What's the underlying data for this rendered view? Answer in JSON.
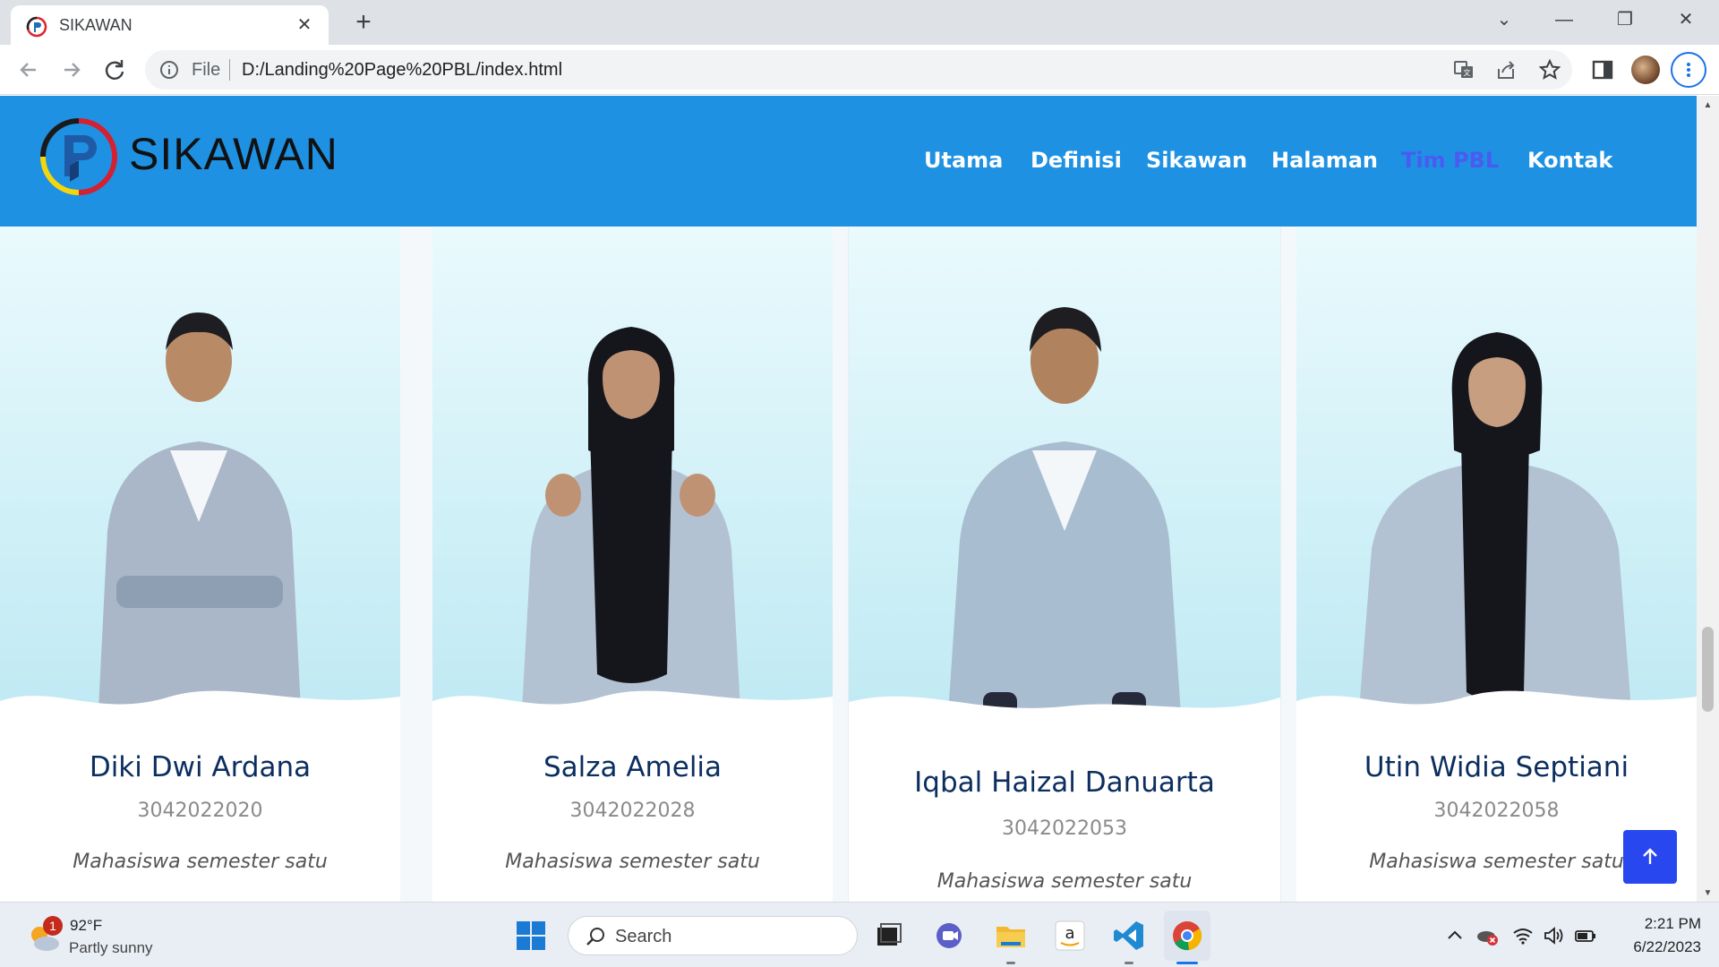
{
  "browser": {
    "tab_title": "SIKAWAN",
    "omnibox_scheme": "File",
    "omnibox_url": "D:/Landing%20Page%20PBL/index.html"
  },
  "site": {
    "logo_text": "SIKAWAN",
    "nav": [
      {
        "label": "Utama",
        "active": false
      },
      {
        "label": "Definisi",
        "active": false
      },
      {
        "label": "Sikawan",
        "active": false
      },
      {
        "label": "Halaman",
        "active": false
      },
      {
        "label": "Tim PBL",
        "active": true
      },
      {
        "label": "Kontak",
        "active": false
      }
    ],
    "accent_color": "#1e91e3",
    "active_nav_color": "#4a5bf2"
  },
  "team": [
    {
      "name": "Diki Dwi Ardana",
      "nim": "3042022020",
      "role": "Mahasiswa semester satu"
    },
    {
      "name": "Salza Amelia",
      "nim": "3042022028",
      "role": "Mahasiswa semester satu"
    },
    {
      "name": "Iqbal Haizal Danuarta",
      "nim": "3042022053",
      "role": "Mahasiswa semester satu"
    },
    {
      "name": "Utin Widia Septiani",
      "nim": "3042022058",
      "role": "Mahasiswa semester satu"
    }
  ],
  "taskbar": {
    "weather_badge": "1",
    "weather_temp": "92°F",
    "weather_desc": "Partly sunny",
    "search_label": "Search",
    "time": "2:21 PM",
    "date": "6/22/2023"
  }
}
